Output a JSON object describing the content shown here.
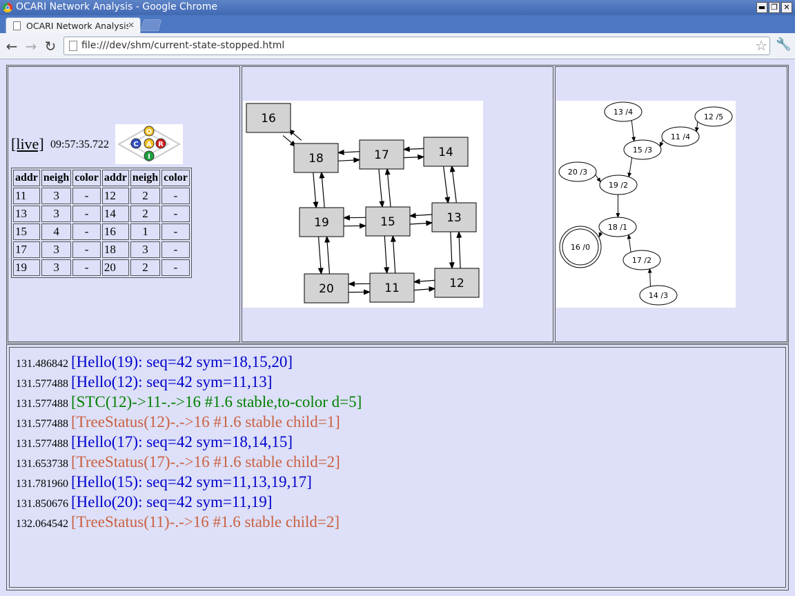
{
  "window": {
    "title": "OCARI Network Analysis - Google Chrome",
    "buttons": [
      "▬",
      "❐",
      "✕"
    ]
  },
  "tab": {
    "label": "OCARI Network Analysis",
    "close": "×"
  },
  "toolbar": {
    "url": "file:///dev/shm/current-state-stopped.html",
    "back": "←",
    "forward": "→",
    "reload": "↻",
    "star": "☆",
    "wrench": "🔧"
  },
  "status": {
    "live_link": "[live]",
    "timestamp": "09:57:35.722"
  },
  "logo": {
    "letters": [
      "O",
      "C",
      "A",
      "R",
      "I"
    ],
    "colors": [
      "#f0c020",
      "#3050c8",
      "#f0c020",
      "#d02020",
      "#20a040"
    ]
  },
  "table": {
    "headers": [
      "addr",
      "neigh",
      "color",
      "addr",
      "neigh",
      "color"
    ],
    "rows": [
      [
        "11",
        "3",
        "-",
        "12",
        "2",
        "-"
      ],
      [
        "13",
        "3",
        "-",
        "14",
        "2",
        "-"
      ],
      [
        "15",
        "4",
        "-",
        "16",
        "1",
        "-"
      ],
      [
        "17",
        "3",
        "-",
        "18",
        "3",
        "-"
      ],
      [
        "19",
        "3",
        "-",
        "20",
        "2",
        "-"
      ]
    ]
  },
  "graph1": {
    "nodes": [
      "16",
      "18",
      "17",
      "14",
      "19",
      "15",
      "13",
      "20",
      "11",
      "12"
    ],
    "edges": [
      [
        "16",
        "18"
      ],
      [
        "18",
        "16"
      ],
      [
        "18",
        "17"
      ],
      [
        "17",
        "18"
      ],
      [
        "17",
        "14"
      ],
      [
        "14",
        "17"
      ],
      [
        "18",
        "19"
      ],
      [
        "19",
        "18"
      ],
      [
        "17",
        "15"
      ],
      [
        "15",
        "17"
      ],
      [
        "14",
        "13"
      ],
      [
        "13",
        "14"
      ],
      [
        "19",
        "15"
      ],
      [
        "15",
        "19"
      ],
      [
        "15",
        "13"
      ],
      [
        "13",
        "15"
      ],
      [
        "19",
        "20"
      ],
      [
        "20",
        "19"
      ],
      [
        "15",
        "11"
      ],
      [
        "11",
        "15"
      ],
      [
        "13",
        "12"
      ],
      [
        "12",
        "13"
      ],
      [
        "20",
        "11"
      ],
      [
        "11",
        "20"
      ],
      [
        "11",
        "12"
      ],
      [
        "12",
        "11"
      ]
    ]
  },
  "graph2": {
    "nodes": [
      "13 /4",
      "12 /5",
      "11 /4",
      "15 /3",
      "20 /3",
      "19 /2",
      "18 /1",
      "16 /0",
      "17 /2",
      "14 /3"
    ],
    "root": "16 /0",
    "edges": [
      [
        "13 /4",
        "15 /3"
      ],
      [
        "12 /5",
        "11 /4"
      ],
      [
        "11 /4",
        "15 /3"
      ],
      [
        "15 /3",
        "19 /2"
      ],
      [
        "20 /3",
        "19 /2"
      ],
      [
        "19 /2",
        "18 /1"
      ],
      [
        "18 /1",
        "16 /0"
      ],
      [
        "17 /2",
        "18 /1"
      ],
      [
        "14 /3",
        "17 /2"
      ]
    ]
  },
  "colors": {
    "hello": "#0000cc",
    "stc": "#008000",
    "tree": "#cc6040"
  },
  "log": [
    {
      "ts": "131.486842",
      "msg": "[Hello(19): seq=42 sym=18,15,20]",
      "kind": "hello"
    },
    {
      "ts": "131.577488",
      "msg": "[Hello(12): seq=42 sym=11,13]",
      "kind": "hello"
    },
    {
      "ts": "131.577488",
      "msg": "[STC(12)->11-.->16 #1.6 stable,to-color d=5]",
      "kind": "stc"
    },
    {
      "ts": "131.577488",
      "msg": "[TreeStatus(12)-.->16 #1.6 stable child=1]",
      "kind": "tree"
    },
    {
      "ts": "131.577488",
      "msg": "[Hello(17): seq=42 sym=18,14,15]",
      "kind": "hello"
    },
    {
      "ts": "131.653738",
      "msg": "[TreeStatus(17)-.->16 #1.6 stable child=2]",
      "kind": "tree"
    },
    {
      "ts": "131.781960",
      "msg": "[Hello(15): seq=42 sym=11,13,19,17]",
      "kind": "hello"
    },
    {
      "ts": "131.850676",
      "msg": "[Hello(20): seq=42 sym=11,19]",
      "kind": "hello"
    },
    {
      "ts": "132.064542",
      "msg": "[TreeStatus(11)-.->16 #1.6 stable child=2]",
      "kind": "tree"
    }
  ]
}
